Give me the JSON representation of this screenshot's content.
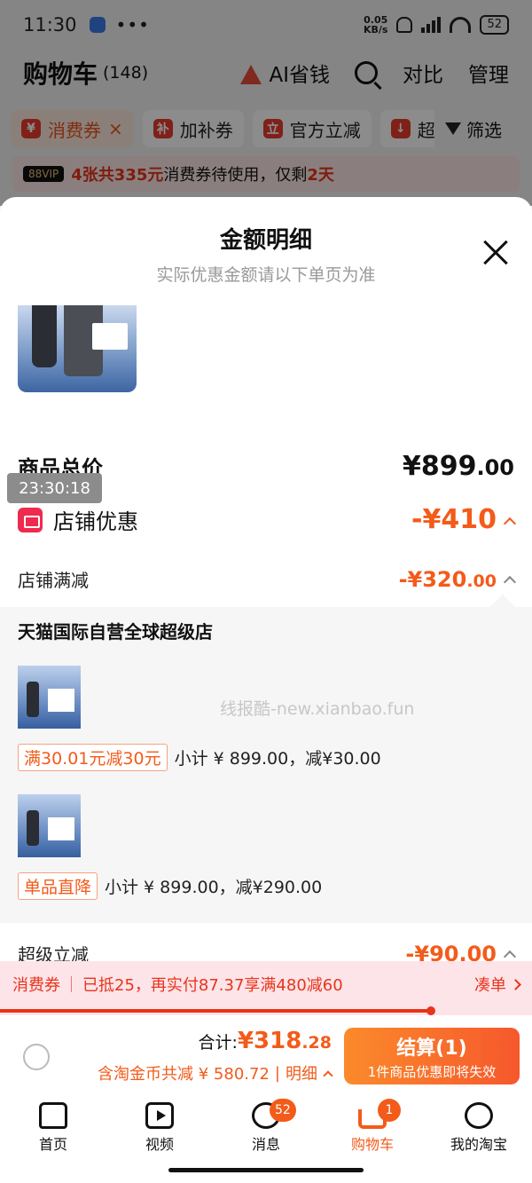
{
  "status_bar": {
    "time": "11:30",
    "dots": "•••",
    "speed_top": "0.05",
    "speed_bottom": "KB/s",
    "battery": "52"
  },
  "top_bar": {
    "title": "购物车",
    "count": "(148)",
    "ai_label": "AI省钱",
    "compare_label": "对比",
    "manage_label": "管理"
  },
  "chips": [
    {
      "badge": "¥",
      "label": "消费券",
      "suffix": "×"
    },
    {
      "badge": "补",
      "label": "加补券"
    },
    {
      "badge": "立",
      "label": "官方立减"
    },
    {
      "badge": "↓",
      "label": "超"
    }
  ],
  "filter_label": "筛选",
  "vip_strip": {
    "tag": "88VIP",
    "highlight": "4张共335元",
    "text": "消费券待使用，仅剩",
    "days": "2天"
  },
  "sheet": {
    "title": "金额明细",
    "subtitle": "实际优惠金额请以下单页为准",
    "goods_total_label": "商品总价",
    "goods_total_int": "¥899",
    "goods_total_dec": ".00",
    "shop_discount_label": "店铺优惠",
    "shop_discount_value": "-¥410",
    "shop_full_reduction_label": "店铺满减",
    "shop_full_reduction_int": "-¥320",
    "shop_full_reduction_dec": ".00",
    "store_name": "天猫国际自营全球超级店",
    "items": [
      {
        "tag": "满30.01元减30元",
        "subtotal": "小计 ¥ 899.00，减¥30.00"
      },
      {
        "tag": "单品直降",
        "subtotal": "小计 ¥ 899.00，减¥290.00"
      }
    ],
    "super_discount_label": "超级立减",
    "super_discount_value": "-¥90.00",
    "watermark": "线报酷-new.xianbao.fun"
  },
  "timestamp": "23:30:18",
  "coupon_bar": {
    "label": "消费券",
    "text": "已抵25，再实付87.37享满480减60",
    "action": "凑单"
  },
  "coupon_progress": 0.81,
  "checkout": {
    "total_label": "合计:",
    "total_int": "¥318",
    "total_dec": ".28",
    "saving_text": "含淘金币共减 ¥ 580.72",
    "detail_label": "明细",
    "pay_label": "结算(1)",
    "pay_sub": "1件商品优惠即将失效"
  },
  "tabbar": [
    {
      "label": "首页",
      "icon": "home-icon"
    },
    {
      "label": "视频",
      "icon": "video-icon"
    },
    {
      "label": "消息",
      "icon": "message-icon",
      "badge": "52"
    },
    {
      "label": "购物车",
      "icon": "cart-icon",
      "badge": "1"
    },
    {
      "label": "我的淘宝",
      "icon": "profile-icon"
    }
  ],
  "colors": {
    "accent": "#f35b1a",
    "danger": "#e8341b",
    "coupon_bg": "#fde4e8"
  }
}
